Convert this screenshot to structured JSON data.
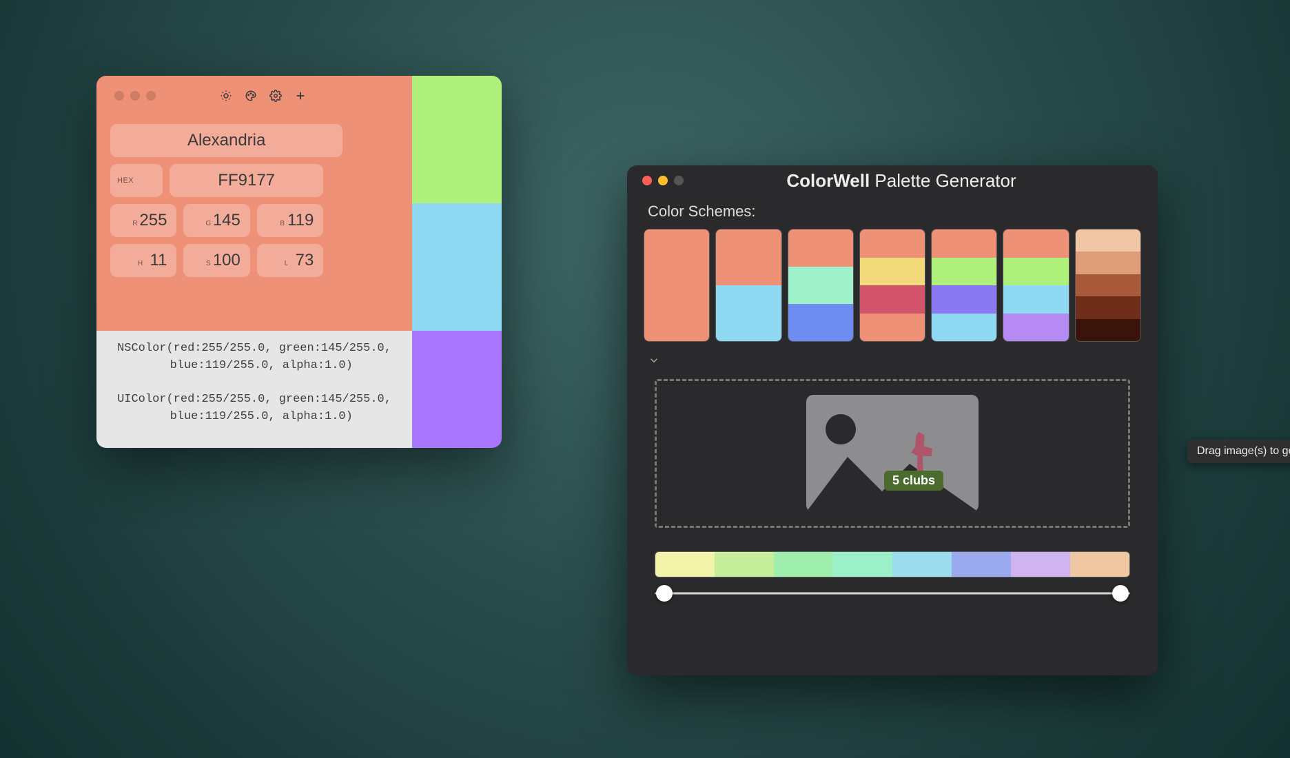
{
  "picker": {
    "name": "Alexandria",
    "hex_label": "HEX",
    "hex": "FF9177",
    "rgb_labels": [
      "R",
      "G",
      "B"
    ],
    "rgb": [
      "255",
      "145",
      "119"
    ],
    "hsl_labels": [
      "H",
      "S",
      "L"
    ],
    "hsl": [
      "11",
      "100",
      "73"
    ],
    "code": "NSColor(red:255/255.0, green:145/255.0,\n  blue:119/255.0, alpha:1.0)\n\nUIColor(red:255/255.0, green:145/255.0,\n  blue:119/255.0, alpha:1.0)",
    "main_color": "#ef9177",
    "side_swatches": [
      "#aef07a",
      "#8fd9f2"
    ],
    "bottom_swatch": "#a876ff",
    "toolbar_icons": [
      "brightness-icon",
      "palette-icon",
      "gear-icon",
      "plus-icon"
    ]
  },
  "generator": {
    "title_bold": "ColorWell",
    "title_rest": " Palette Generator",
    "schemes_label": "Color Schemes:",
    "schemes": [
      [
        "#ef9177"
      ],
      [
        "#ef9177",
        "#8fd9f2"
      ],
      [
        "#ef9177",
        "#9ff2c9",
        "#6f8df0"
      ],
      [
        "#ef9177",
        "#f2da7a",
        "#d1546a",
        "#ef9177"
      ],
      [
        "#ef9177",
        "#aef07a",
        "#8a78f0",
        "#8fd9f2"
      ],
      [
        "#ef9177",
        "#aef07a",
        "#8fd9f2",
        "#b58af2"
      ],
      [
        "#f0c6a6",
        "#e09e78",
        "#a85a3a",
        "#6e2e1a",
        "#3a140b"
      ]
    ],
    "drag_label": "5 clubs",
    "tooltip": "Drag image(s) to generate a color Palette",
    "gradient": [
      "#f3f2a9",
      "#c7ef9b",
      "#9eefae",
      "#9befc9",
      "#9bdcef",
      "#9ba9ef",
      "#cfb4ef",
      "#efc7a3"
    ],
    "slider": {
      "min_pos": 0,
      "max_pos": 100
    }
  }
}
